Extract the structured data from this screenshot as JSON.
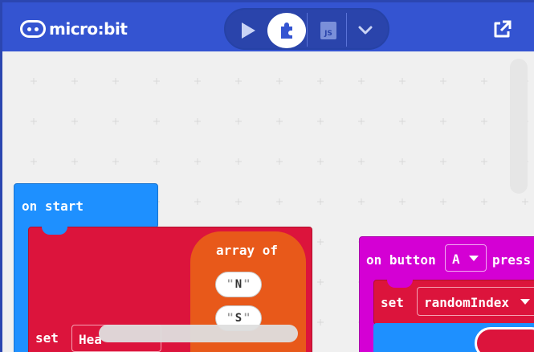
{
  "header": {
    "logo_text": "micro:bit",
    "mode_toggle": {
      "js_label": "JS"
    },
    "colors": {
      "bar": "#3454d1",
      "toggle": "#2a44ab"
    }
  },
  "workspace": {
    "on_start": {
      "label": "on start",
      "set_keyword": "set",
      "variable": "Hea",
      "array_label": "array of",
      "array_items": [
        "N",
        "S"
      ]
    },
    "on_button": {
      "prefix": "on button",
      "button": "A",
      "suffix": "press",
      "set_keyword": "set",
      "variable": "randomIndex"
    },
    "colors": {
      "event": "#1e90ff",
      "variables": "#dc143c",
      "arrays": "#e8591a",
      "input": "#d400d4"
    }
  }
}
